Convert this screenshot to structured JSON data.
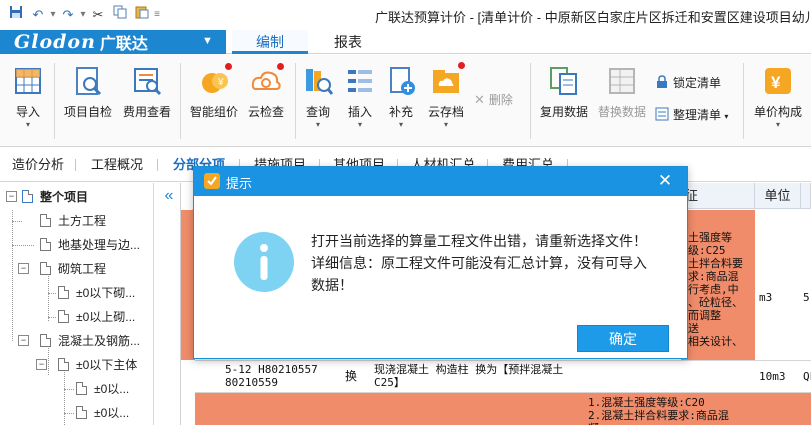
{
  "window": {
    "title": "广联达预算计价 - [清单计价 - 中原新区白家庄片区拆迁和安置区建设项目幼儿园-"
  },
  "quick_access": {
    "icons": [
      "save-icon",
      "undo-icon",
      "redo-icon",
      "cut-icon",
      "copy-icon",
      "paste-icon"
    ]
  },
  "brand": {
    "logo_text": "Glodon",
    "logo_cn": "广联达"
  },
  "ribbon_tabs": [
    "编制",
    "报表"
  ],
  "toolbar": {
    "import": "导入",
    "self_check": "项目自检",
    "fee_view": "费用查看",
    "smart_price": "智能组价",
    "cloud_check": "云检查",
    "query": "查询",
    "insert": "插入",
    "supplement": "补充",
    "cloud_save": "云存档",
    "delete": "删除",
    "reuse": "复用数据",
    "replace": "替换数据",
    "lock_list": "锁定清单",
    "organize_list": "整理清单",
    "unit_price": "单价构成"
  },
  "subtabs": [
    "造价分析",
    "工程概况",
    "分部分项",
    "措施项目",
    "其他项目",
    "人材机汇总",
    "费用汇总"
  ],
  "tree": [
    {
      "label": "整个项目",
      "level": 0,
      "toggle": "−"
    },
    {
      "label": "土方工程",
      "level": 1
    },
    {
      "label": "地基处理与边...",
      "level": 1
    },
    {
      "label": "砌筑工程",
      "level": 1,
      "toggle": "−"
    },
    {
      "label": "±0以下砌...",
      "level": 2
    },
    {
      "label": "±0以上砌...",
      "level": 2
    },
    {
      "label": "混凝土及钢筋...",
      "level": 1,
      "toggle": "−"
    },
    {
      "label": "±0以下主体",
      "level": 2,
      "toggle": "−"
    },
    {
      "label": "±0以...",
      "level": 3
    },
    {
      "label": "±0以...",
      "level": 3
    }
  ],
  "grid": {
    "headers": {
      "feature": "征",
      "unit": "单位"
    },
    "row_marker": "B",
    "features_1": [
      "土强度等级:C25",
      "土拌合料要求:商品混",
      "",
      "行考虑,中",
      "、砼粒径、",
      "而调整",
      "送",
      "相关设计、"
    ],
    "unit_1": "m3",
    "qty_1": "5(",
    "code_line1": "5-12 H80210557",
    "code_line2": "80210559",
    "type_label": "换",
    "name_line1": "现浇混凝土 构造柱  换为【预拌混凝土",
    "name_line2": "C25】",
    "unit_2": "10m3",
    "qty_2": "QL",
    "features_2": [
      "1.混凝土强度等级:C20",
      "2.混凝土拌合料要求:商品混",
      "凝"
    ]
  },
  "dialog": {
    "title": "提示",
    "message": "打开当前选择的算量工程文件出错，请重新选择文件！ 详细信息：原工程文件可能没有汇总计算，没有可导入数据！",
    "ok_label": "确定"
  },
  "colors": {
    "accent": "#1d86d1",
    "dialog_title": "#1a93e2",
    "row_highlight": "#f08c6a",
    "info_icon": "#7fd3f2"
  }
}
